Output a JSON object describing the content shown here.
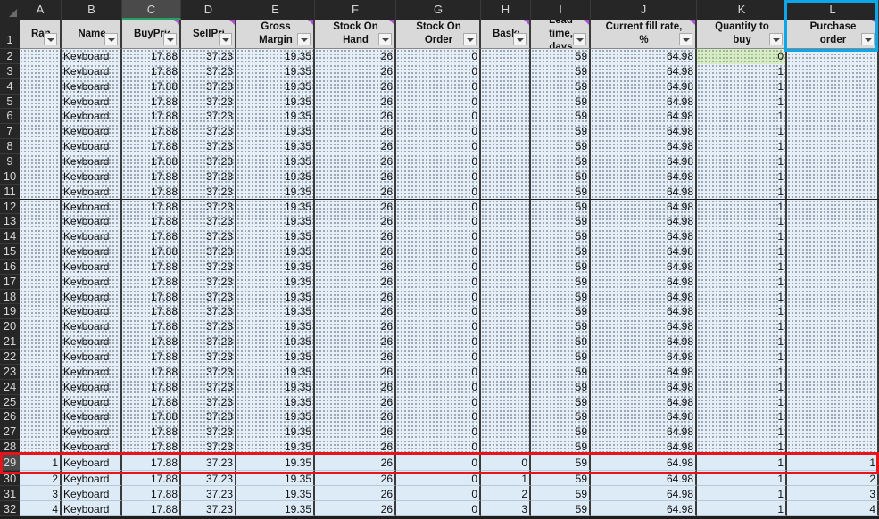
{
  "columns": [
    "A",
    "B",
    "C",
    "D",
    "E",
    "F",
    "G",
    "H",
    "I",
    "J",
    "K",
    "L"
  ],
  "selected_column": "C",
  "headers": [
    "Rank",
    "Name",
    "BuyPrice",
    "SellPrice",
    "Gross Margin",
    "Stock On Hand",
    "Stock On Order",
    "Basket",
    "Lead time, days",
    "Current fill rate, %",
    "Quantity to buy",
    "Purchase order"
  ],
  "header_comment_columns": [
    "C",
    "D",
    "E",
    "F",
    "H",
    "I",
    "J",
    "L"
  ],
  "rows": [
    {
      "n": "2",
      "cells": [
        "",
        "Keyboard",
        "17.88",
        "37.23",
        "19.35",
        "26",
        "0",
        "",
        "59",
        "64.98",
        "0",
        ""
      ]
    },
    {
      "n": "3",
      "cells": [
        "",
        "Keyboard",
        "17.88",
        "37.23",
        "19.35",
        "26",
        "0",
        "",
        "59",
        "64.98",
        "1",
        ""
      ]
    },
    {
      "n": "4",
      "cells": [
        "",
        "Keyboard",
        "17.88",
        "37.23",
        "19.35",
        "26",
        "0",
        "",
        "59",
        "64.98",
        "1",
        ""
      ]
    },
    {
      "n": "5",
      "cells": [
        "",
        "Keyboard",
        "17.88",
        "37.23",
        "19.35",
        "26",
        "0",
        "",
        "59",
        "64.98",
        "1",
        ""
      ]
    },
    {
      "n": "6",
      "cells": [
        "",
        "Keyboard",
        "17.88",
        "37.23",
        "19.35",
        "26",
        "0",
        "",
        "59",
        "64.98",
        "1",
        ""
      ]
    },
    {
      "n": "7",
      "cells": [
        "",
        "Keyboard",
        "17.88",
        "37.23",
        "19.35",
        "26",
        "0",
        "",
        "59",
        "64.98",
        "1",
        ""
      ]
    },
    {
      "n": "8",
      "cells": [
        "",
        "Keyboard",
        "17.88",
        "37.23",
        "19.35",
        "26",
        "0",
        "",
        "59",
        "64.98",
        "1",
        ""
      ]
    },
    {
      "n": "9",
      "cells": [
        "",
        "Keyboard",
        "17.88",
        "37.23",
        "19.35",
        "26",
        "0",
        "",
        "59",
        "64.98",
        "1",
        ""
      ]
    },
    {
      "n": "10",
      "cells": [
        "",
        "Keyboard",
        "17.88",
        "37.23",
        "19.35",
        "26",
        "0",
        "",
        "59",
        "64.98",
        "1",
        ""
      ]
    },
    {
      "n": "11",
      "cells": [
        "",
        "Keyboard",
        "17.88",
        "37.23",
        "19.35",
        "26",
        "0",
        "",
        "59",
        "64.98",
        "1",
        ""
      ]
    },
    {
      "n": "12",
      "cells": [
        "",
        "Keyboard",
        "17.88",
        "37.23",
        "19.35",
        "26",
        "0",
        "",
        "59",
        "64.98",
        "1",
        ""
      ]
    },
    {
      "n": "13",
      "cells": [
        "",
        "Keyboard",
        "17.88",
        "37.23",
        "19.35",
        "26",
        "0",
        "",
        "59",
        "64.98",
        "1",
        ""
      ]
    },
    {
      "n": "14",
      "cells": [
        "",
        "Keyboard",
        "17.88",
        "37.23",
        "19.35",
        "26",
        "0",
        "",
        "59",
        "64.98",
        "1",
        ""
      ]
    },
    {
      "n": "15",
      "cells": [
        "",
        "Keyboard",
        "17.88",
        "37.23",
        "19.35",
        "26",
        "0",
        "",
        "59",
        "64.98",
        "1",
        ""
      ]
    },
    {
      "n": "16",
      "cells": [
        "",
        "Keyboard",
        "17.88",
        "37.23",
        "19.35",
        "26",
        "0",
        "",
        "59",
        "64.98",
        "1",
        ""
      ]
    },
    {
      "n": "17",
      "cells": [
        "",
        "Keyboard",
        "17.88",
        "37.23",
        "19.35",
        "26",
        "0",
        "",
        "59",
        "64.98",
        "1",
        ""
      ]
    },
    {
      "n": "18",
      "cells": [
        "",
        "Keyboard",
        "17.88",
        "37.23",
        "19.35",
        "26",
        "0",
        "",
        "59",
        "64.98",
        "1",
        ""
      ]
    },
    {
      "n": "19",
      "cells": [
        "",
        "Keyboard",
        "17.88",
        "37.23",
        "19.35",
        "26",
        "0",
        "",
        "59",
        "64.98",
        "1",
        ""
      ]
    },
    {
      "n": "20",
      "cells": [
        "",
        "Keyboard",
        "17.88",
        "37.23",
        "19.35",
        "26",
        "0",
        "",
        "59",
        "64.98",
        "1",
        ""
      ]
    },
    {
      "n": "21",
      "cells": [
        "",
        "Keyboard",
        "17.88",
        "37.23",
        "19.35",
        "26",
        "0",
        "",
        "59",
        "64.98",
        "1",
        ""
      ]
    },
    {
      "n": "22",
      "cells": [
        "",
        "Keyboard",
        "17.88",
        "37.23",
        "19.35",
        "26",
        "0",
        "",
        "59",
        "64.98",
        "1",
        ""
      ]
    },
    {
      "n": "23",
      "cells": [
        "",
        "Keyboard",
        "17.88",
        "37.23",
        "19.35",
        "26",
        "0",
        "",
        "59",
        "64.98",
        "1",
        ""
      ]
    },
    {
      "n": "24",
      "cells": [
        "",
        "Keyboard",
        "17.88",
        "37.23",
        "19.35",
        "26",
        "0",
        "",
        "59",
        "64.98",
        "1",
        ""
      ]
    },
    {
      "n": "25",
      "cells": [
        "",
        "Keyboard",
        "17.88",
        "37.23",
        "19.35",
        "26",
        "0",
        "",
        "59",
        "64.98",
        "1",
        ""
      ]
    },
    {
      "n": "26",
      "cells": [
        "",
        "Keyboard",
        "17.88",
        "37.23",
        "19.35",
        "26",
        "0",
        "",
        "59",
        "64.98",
        "1",
        ""
      ]
    },
    {
      "n": "27",
      "cells": [
        "",
        "Keyboard",
        "17.88",
        "37.23",
        "19.35",
        "26",
        "0",
        "",
        "59",
        "64.98",
        "1",
        ""
      ]
    },
    {
      "n": "28",
      "cells": [
        "",
        "Keyboard",
        "17.88",
        "37.23",
        "19.35",
        "26",
        "0",
        "",
        "59",
        "64.98",
        "1",
        ""
      ]
    },
    {
      "n": "29",
      "cells": [
        "1",
        "Keyboard",
        "17.88",
        "37.23",
        "19.35",
        "26",
        "0",
        "0",
        "59",
        "64.98",
        "1",
        "1"
      ],
      "highlight": true
    },
    {
      "n": "30",
      "cells": [
        "2",
        "Keyboard",
        "17.88",
        "37.23",
        "19.35",
        "26",
        "0",
        "1",
        "59",
        "64.98",
        "1",
        "2"
      ]
    },
    {
      "n": "31",
      "cells": [
        "3",
        "Keyboard",
        "17.88",
        "37.23",
        "19.35",
        "26",
        "0",
        "2",
        "59",
        "64.98",
        "1",
        "3"
      ]
    },
    {
      "n": "32",
      "cells": [
        "4",
        "Keyboard",
        "17.88",
        "37.23",
        "19.35",
        "26",
        "0",
        "3",
        "59",
        "64.98",
        "1",
        "4"
      ]
    }
  ],
  "colors": {
    "highlight_box": "#e8141c",
    "column_box": "#0ea5e9",
    "header_fill": "#d9d9d9",
    "row_fill": "#ddebf7"
  }
}
